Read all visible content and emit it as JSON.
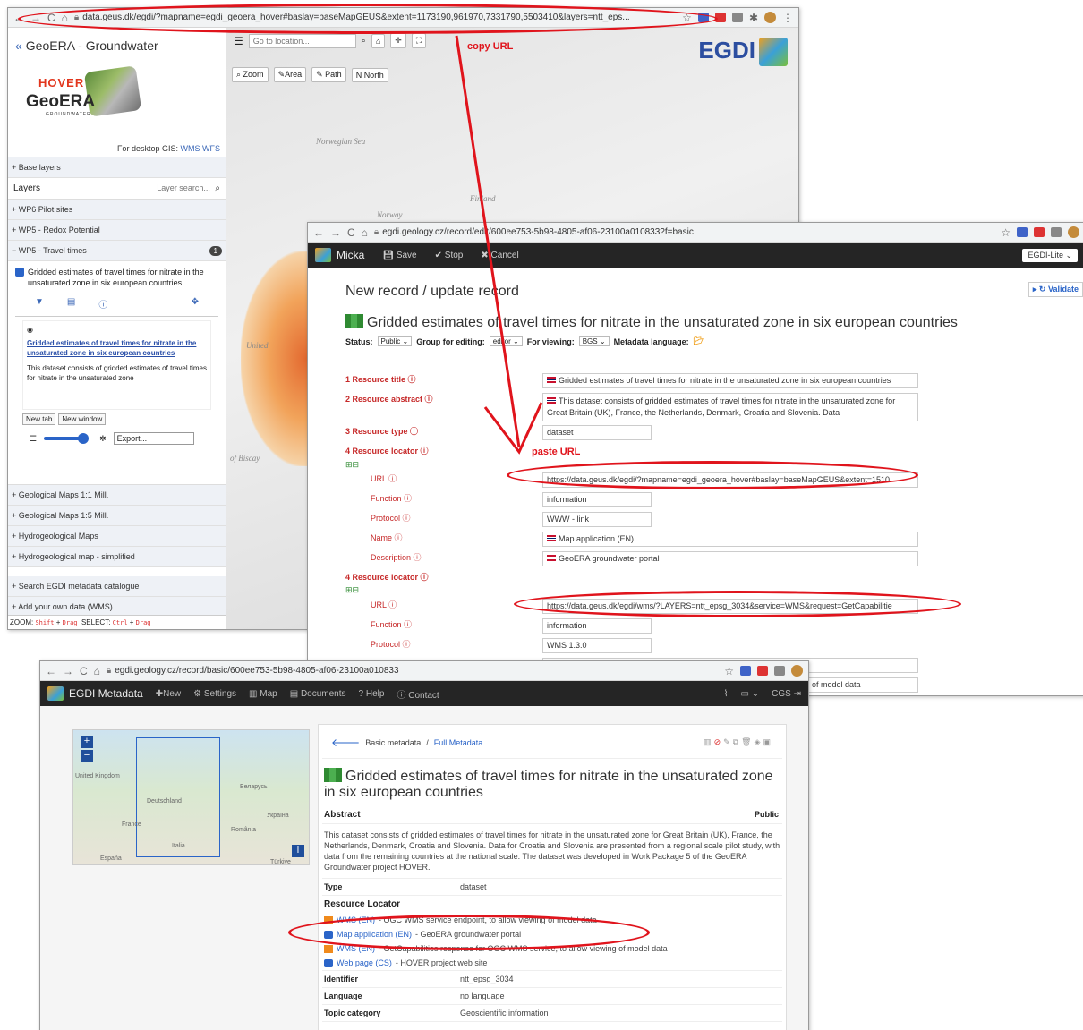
{
  "w1": {
    "url": "data.geus.dk/egdi/?mapname=egdi_geoera_hover#baslay=baseMapGEUS&extent=1173190,961970,7331790,5503410&layers=ntt_eps...",
    "title": "GeoERA - Groundwater",
    "logo_hover": "HOVER",
    "logo_geo": "GeoERA",
    "logo_gw": "GROUNDWATER",
    "desktop_label": "For desktop GIS:",
    "wms": "WMS",
    "wfs": "WFS",
    "base_layers": "+ Base layers",
    "layers": "Layers",
    "layer_search": "Layer search...",
    "wp6": "+ WP6 Pilot sites",
    "wp5_redox": "+ WP5 - Redox Potential",
    "wp5_travel": "− WP5 - Travel times",
    "wp5_badge": "1",
    "layer_checked": "Gridded estimates of travel times for nitrate in the unsaturated zone in six european countries",
    "info_link": "Gridded estimates of travel times for nitrate in the unsaturated zone in six european countries",
    "info_text": "This dataset consists of gridded estimates of travel times for nitrate in the unsaturated zone",
    "new_tab": "New tab",
    "new_window": "New window",
    "export": "Export...",
    "geo_1m": "+ Geological Maps 1:1 Mill.",
    "geo_15m": "+ Geological Maps 1:5 Mill.",
    "hydro": "+ Hydrogeological Maps",
    "hydro_s": "+ Hydrogeological map - simplified",
    "search_cat": "+ Search EGDI metadata catalogue",
    "add_data": "+ Add your own data (WMS)",
    "zoom_lbl": "ZOOM:",
    "shift": "Shift",
    "drag": "Drag",
    "select_lbl": "SELECT:",
    "ctrl": "Ctrl",
    "goto": "Go to location...",
    "zoom_btn": "Zoom",
    "area_btn": "Area",
    "path_btn": "Path",
    "north_btn": "North",
    "egdi": "EGDI",
    "norwegian_sea": "Norwegian Sea",
    "norway": "Norway",
    "finland": "Finland",
    "united": "United",
    "biscay": "of Biscay",
    "copy_url": "copy URL"
  },
  "w2": {
    "url": "egdi.geology.cz/record/edit/600ee753-5b98-4805-af06-23100a010833?f=basic",
    "brand": "Micka",
    "save": "Save",
    "stop": "Stop",
    "cancel": "Cancel",
    "lite": "EGDI-Lite",
    "validate": "Validate",
    "heading": "New record / update record",
    "title": "Gridded estimates of travel times for nitrate in the unsaturated zone in six european countries",
    "status_lbl": "Status:",
    "status_val": "Public",
    "group_lbl": "Group for editing:",
    "group_val": "editor",
    "view_lbl": "For viewing:",
    "view_val": "BGS",
    "lang_lbl": "Metadata language:",
    "f1": "1 Resource title",
    "f1_val": "Gridded estimates of travel times for nitrate in the unsaturated zone in six european countries",
    "f2": "2 Resource abstract",
    "f2_val": "This dataset consists of gridded estimates of travel times for nitrate in the unsaturated zone for Great Britain (UK), France, the Netherlands, Denmark, Croatia and Slovenia. Data",
    "f3": "3 Resource type",
    "f3_val": "dataset",
    "f4": "4 Resource locator",
    "paste_url": "paste URL",
    "url_lbl": "URL",
    "url1": "https://data.geus.dk/egdi/?mapname=egdi_geoera_hover#baslay=baseMapGEUS&extent=1510",
    "function_lbl": "Function",
    "function1": "information",
    "protocol_lbl": "Protocol",
    "protocol1": "WWW - link",
    "name_lbl": "Name",
    "name1": "Map application (EN)",
    "desc_lbl": "Description",
    "desc1": "GeoERA groundwater portal",
    "url2": "https://data.geus.dk/egdi/wms/?LAYERS=ntt_epsg_3034&service=WMS&request=GetCapabilitie",
    "function2": "information",
    "protocol2": "WMS 1.3.0",
    "desc2": "of model data"
  },
  "w3": {
    "url": "egdi.geology.cz/record/basic/600ee753-5b98-4805-af06-23100a010833",
    "brand": "EGDI Metadata",
    "new": "New",
    "settings": "Settings",
    "map": "Map",
    "documents": "Documents",
    "help": "Help",
    "contact": "Contact",
    "user": "CGS",
    "basic": "Basic metadata",
    "full": "Full Metadata",
    "title": "Gridded estimates of travel times for nitrate in the unsaturated zone in six european countries",
    "abstract_lbl": "Abstract",
    "public": "Public",
    "abstract": "This dataset consists of gridded estimates of travel times for nitrate in the unsaturated zone for Great Britain (UK), France, the Netherlands, Denmark, Croatia and Slovenia. Data for Croatia and Slovenia are presented from a regional scale pilot study, with data from the remaining countries at the national scale. The dataset was developed in Work Package 5 of the GeoERA Groundwater project HOVER.",
    "type_lbl": "Type",
    "type_val": "dataset",
    "rl_lbl": "Resource Locator",
    "rl1_link": "WMS (EN)",
    "rl1_text": "- OGC WMS service endpoint, to allow viewing of model data",
    "rl2_link": "Map application (EN)",
    "rl2_text": "- GeoERA groundwater portal",
    "rl3_link": "WMS (EN)",
    "rl3_text": "- GetCapabilities response for OGC WMS service, to allow viewing of model data",
    "rl4_link": "Web page (CS)",
    "rl4_text": "- HOVER project web site",
    "id_lbl": "Identifier",
    "id_val": "ntt_epsg_3034",
    "lang_lbl": "Language",
    "lang_val": "no language",
    "topic_lbl": "Topic category",
    "topic_val": "Geoscientific information",
    "map_uk": "United Kingdom",
    "map_de": "Deutschland",
    "map_fr": "France",
    "map_by": "Беларусь",
    "map_ua": "Україна",
    "map_ro": "România",
    "map_it": "Italia",
    "map_es": "España",
    "map_tr": "Türkiye"
  }
}
